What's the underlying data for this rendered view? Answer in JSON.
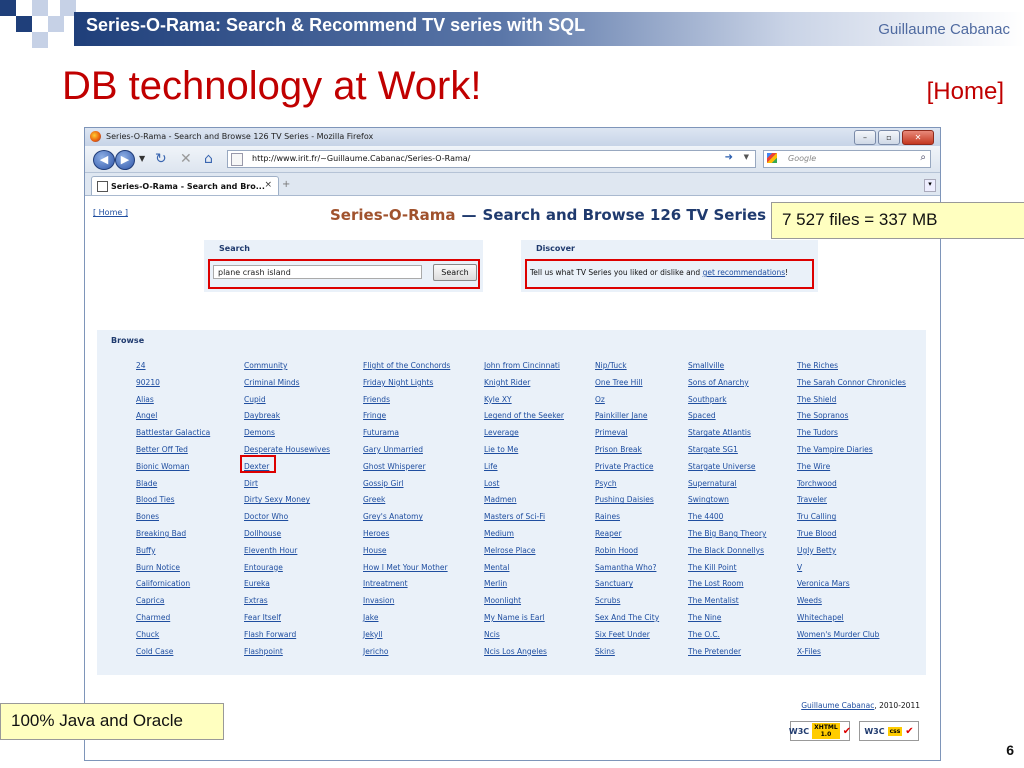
{
  "slide": {
    "title": "Series-O-Rama: Search & Recommend TV series with SQL",
    "author": "Guillaume Cabanac",
    "headline": "DB technology at Work!",
    "home_link": "[Home]",
    "page_number": "6",
    "callout_files": "7 527 files = 337 MB",
    "callout_tech": "100% Java and Oracle",
    "colors": {
      "title_red": "#c00000",
      "title_bar": "#1f3f7a",
      "callout_bg": "#ffffc0",
      "highlight_red": "#dd0000"
    }
  },
  "browser": {
    "window_title": "Series-O-Rama - Search and Browse 126 TV Series - Mozilla Firefox",
    "url": "http://www.irit.fr/~Guillaume.Cabanac/Series-O-Rama/",
    "search_engine_placeholder": "Google",
    "tab_label": "Series-O-Rama - Search and Bro...",
    "tab_close": "×",
    "new_tab": "+"
  },
  "page": {
    "home_link": "[ Home ]",
    "site_name": "Series-O-Rama",
    "separator": "—",
    "subtitle": "Search and Browse 126 TV Series",
    "search": {
      "title": "Search",
      "value": "plane crash island",
      "button": "Search"
    },
    "discover": {
      "title": "Discover",
      "text_before": "Tell us what TV Series you liked or dislike and ",
      "link": "get recommendations",
      "text_after": "!"
    },
    "browse": {
      "title": "Browse",
      "columns": [
        [
          "24",
          "90210",
          "Alias",
          "Angel",
          "Battlestar Galactica",
          "Better Off Ted",
          "Bionic Woman",
          "Blade",
          "Blood Ties",
          "Bones",
          "Breaking Bad",
          "Buffy",
          "Burn Notice",
          "Californication",
          "Caprica",
          "Charmed",
          "Chuck",
          "Cold Case"
        ],
        [
          "Community",
          "Criminal Minds",
          "Cupid",
          "Daybreak",
          "Demons",
          "Desperate Housewives",
          "Dexter",
          "Dirt",
          "Dirty Sexy Money",
          "Doctor Who",
          "Dollhouse",
          "Eleventh Hour",
          "Entourage",
          "Eureka",
          "Extras",
          "Fear Itself",
          "Flash Forward",
          "Flashpoint"
        ],
        [
          "Flight of the Conchords",
          "Friday Night Lights",
          "Friends",
          "Fringe",
          "Futurama",
          "Gary Unmarried",
          "Ghost Whisperer",
          "Gossip Girl",
          "Greek",
          "Grey's Anatomy",
          "Heroes",
          "House",
          "How I Met Your Mother",
          "Intreatment",
          "Invasion",
          "Jake",
          "Jekyll",
          "Jericho"
        ],
        [
          "John from Cincinnati",
          "Knight Rider",
          "Kyle XY",
          "Legend of the Seeker",
          "Leverage",
          "Lie to Me",
          "Life",
          "Lost",
          "Madmen",
          "Masters of Sci-Fi",
          "Medium",
          "Melrose Place",
          "Mental",
          "Merlin",
          "Moonlight",
          "My Name is Earl",
          "Ncis",
          "Ncis Los Angeles"
        ],
        [
          "Nip/Tuck",
          "One Tree Hill",
          "Oz",
          "Painkiller Jane",
          "Primeval",
          "Prison Break",
          "Private Practice",
          "Psych",
          "Pushing Daisies",
          "Raines",
          "Reaper",
          "Robin Hood",
          "Samantha Who?",
          "Sanctuary",
          "Scrubs",
          "Sex And The City",
          "Six Feet Under",
          "Skins"
        ],
        [
          "Smallville",
          "Sons of Anarchy",
          "Southpark",
          "Spaced",
          "Stargate Atlantis",
          "Stargate SG1",
          "Stargate Universe",
          "Supernatural",
          "Swingtown",
          "The 4400",
          "The Big Bang Theory",
          "The Black Donnellys",
          "The Kill Point",
          "The Lost Room",
          "The Mentalist",
          "The Nine",
          "The O.C.",
          "The Pretender"
        ],
        [
          "The Riches",
          "The Sarah Connor Chronicles",
          "The Shield",
          "The Sopranos",
          "The Tudors",
          "The Vampire Diaries",
          "The Wire",
          "Torchwood",
          "Traveler",
          "Tru Calling",
          "True Blood",
          "Ugly Betty",
          "V",
          "Veronica Mars",
          "Weeds",
          "Whitechapel",
          "Women's Murder Club",
          "X-Files"
        ]
      ]
    },
    "footer": {
      "author_link": "Guillaume Cabanac",
      "years": ", 2010-2011",
      "badge_xhtml": "XHTML 1.0",
      "badge_css": "css",
      "w3c": "W3C"
    }
  }
}
